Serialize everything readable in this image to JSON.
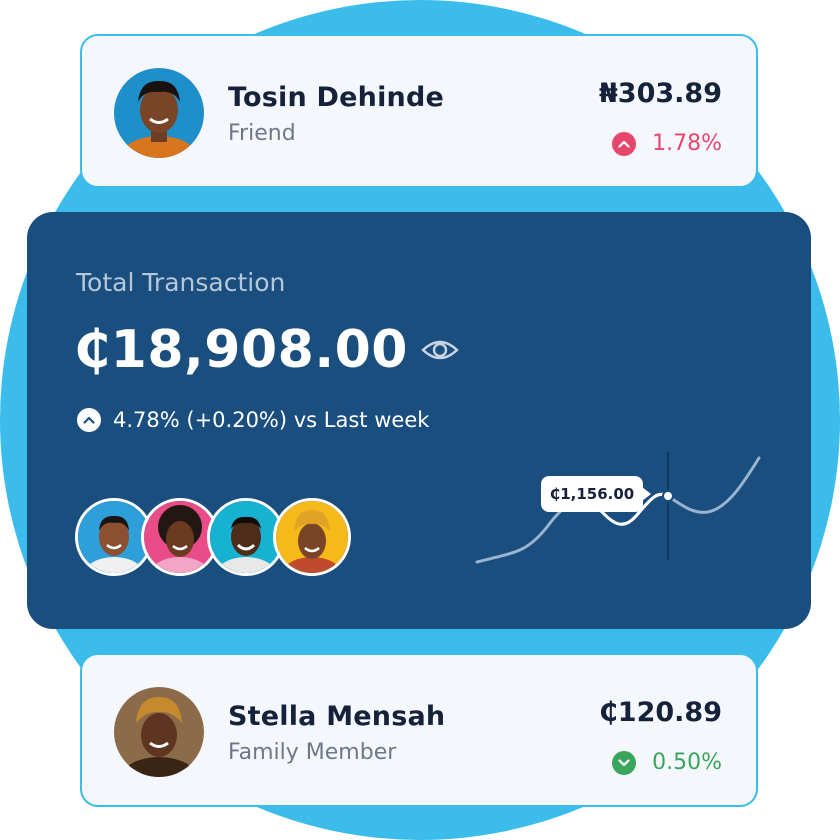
{
  "contacts": [
    {
      "name": "Tosin Dehinde",
      "role": "Friend",
      "amount": "₦303.89",
      "change": "1.78%",
      "change_direction": "up",
      "change_color": "#e8476d"
    },
    {
      "name": "Stella Mensah",
      "role": "Family Member",
      "amount": "₵120.89",
      "change": "0.50%",
      "change_direction": "down",
      "change_color": "#3aa55d"
    }
  ],
  "summary": {
    "title": "Total Transaction",
    "amount": "₵18,908.00",
    "visibility_icon": "eye-icon",
    "change_icon": "chevron-up-icon",
    "week_change": "4.78% (+0.20%) vs Last week"
  },
  "chart": {
    "tooltip_value": "₵1,156.00"
  },
  "colors": {
    "accent": "#3bbcea",
    "card_dark": "#1a4e7f",
    "negative": "#e8476d",
    "positive": "#3aa55d"
  }
}
